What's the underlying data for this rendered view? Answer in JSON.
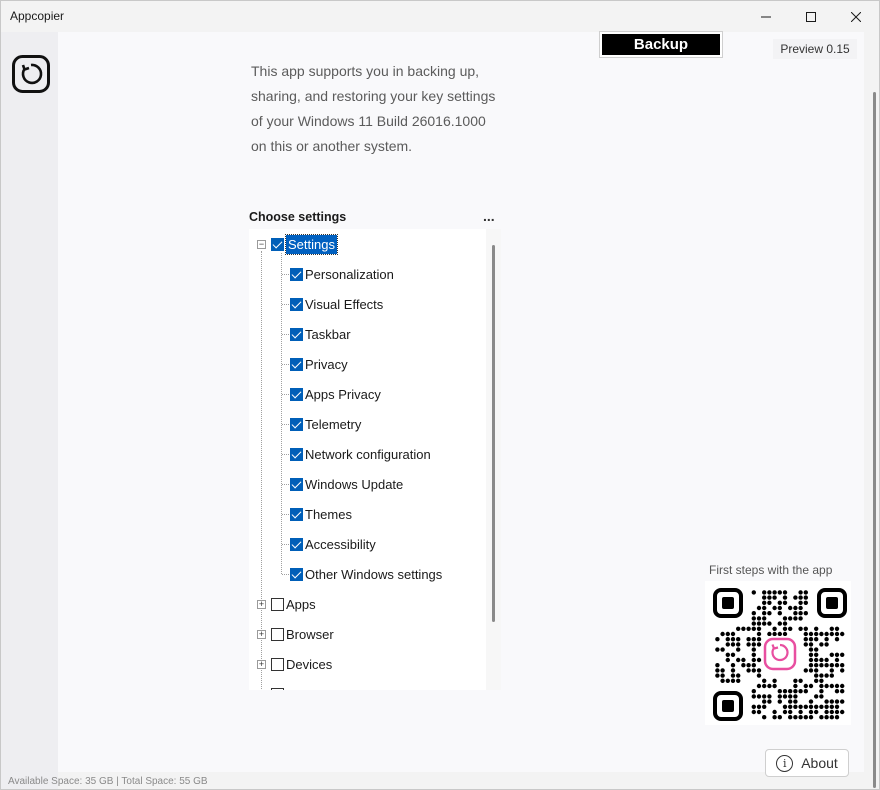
{
  "window": {
    "title": "Appcopier"
  },
  "header": {
    "backup_label": "Backup",
    "preview_label": "Preview 0.15"
  },
  "intro": {
    "text": "This app supports you in backing up, sharing, and restoring your key settings of your Windows 11 Build 26016.1000 on this or another system."
  },
  "settings_panel": {
    "title": "Choose settings",
    "more_label": "...",
    "tree": {
      "root": {
        "label": "Settings",
        "checked": true,
        "expanded": true,
        "selected": true
      },
      "children": [
        {
          "label": "Personalization",
          "checked": true
        },
        {
          "label": "Visual Effects",
          "checked": true
        },
        {
          "label": "Taskbar",
          "checked": true
        },
        {
          "label": "Privacy",
          "checked": true
        },
        {
          "label": "Apps Privacy",
          "checked": true
        },
        {
          "label": "Telemetry",
          "checked": true
        },
        {
          "label": "Network configuration",
          "checked": true
        },
        {
          "label": "Windows Update",
          "checked": true
        },
        {
          "label": "Themes",
          "checked": true
        },
        {
          "label": "Accessibility",
          "checked": true
        },
        {
          "label": "Other Windows settings",
          "checked": true
        }
      ],
      "other_roots": [
        {
          "label": "Apps",
          "checked": false,
          "expanded": false
        },
        {
          "label": "Browser",
          "checked": false,
          "expanded": false
        },
        {
          "label": "Devices",
          "checked": false,
          "expanded": false
        }
      ]
    }
  },
  "qr": {
    "caption": "First steps with the app",
    "accent": "#e84fa0"
  },
  "about": {
    "label": "About",
    "icon": "info-icon"
  },
  "status": {
    "text": "Available Space: 35 GB | Total Space: 55 GB"
  },
  "colors": {
    "accent": "#005fb8",
    "selection": "#0060c0"
  }
}
